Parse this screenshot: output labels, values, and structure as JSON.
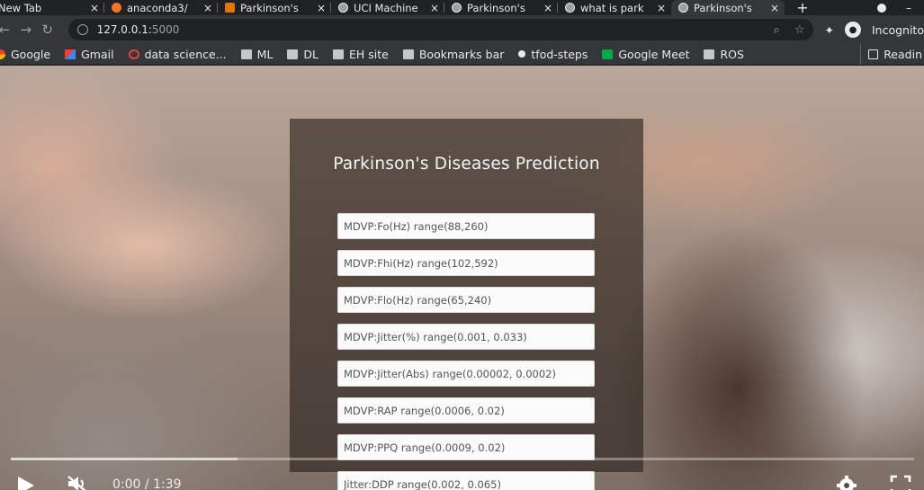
{
  "browser": {
    "tabs": [
      {
        "title": "New Tab",
        "icon": "none",
        "active": false
      },
      {
        "title": "anaconda3/",
        "icon": "jupyter-icon",
        "active": false
      },
      {
        "title": "Parkinson's",
        "icon": "document-icon",
        "active": false
      },
      {
        "title": "UCI Machine",
        "icon": "globe-icon",
        "active": false
      },
      {
        "title": "Parkinson's",
        "icon": "globe-icon",
        "active": false
      },
      {
        "title": "what is park",
        "icon": "globe-icon",
        "active": false
      },
      {
        "title": "Parkinson's",
        "icon": "globe-icon",
        "active": true
      }
    ],
    "tab_close_glyph": "×",
    "new_tab_glyph": "+",
    "url_host": "127.0.0.1:",
    "url_port": "5000",
    "profile_label": "Incognito",
    "bookmarks": [
      {
        "label": "Google",
        "icon": "google-icon"
      },
      {
        "label": "Gmail",
        "icon": "gmail-icon"
      },
      {
        "label": "data science...",
        "icon": "ds-icon"
      },
      {
        "label": "ML",
        "icon": "folder-icon"
      },
      {
        "label": "DL",
        "icon": "folder-icon"
      },
      {
        "label": "EH site",
        "icon": "folder-icon"
      },
      {
        "label": "Bookmarks bar",
        "icon": "folder-icon"
      },
      {
        "label": "tfod-steps",
        "icon": "tf-icon"
      },
      {
        "label": "Google Meet",
        "icon": "meet-icon"
      },
      {
        "label": "ROS",
        "icon": "folder-icon"
      }
    ],
    "reading_list_label": "Readin"
  },
  "page": {
    "title": "Parkinson's Diseases Prediction",
    "fields": [
      "MDVP:Fo(Hz) range(88,260)",
      "MDVP:Fhi(Hz) range(102,592)",
      "MDVP:Flo(Hz) range(65,240)",
      "MDVP:Jitter(%) range(0.001, 0.033)",
      "MDVP:Jitter(Abs) range(0.00002, 0.0002)",
      "MDVP:RAP range(0.0006, 0.02)",
      "MDVP:PPQ range(0.0009, 0.02)",
      "Jitter:DDP range(0.002, 0.065)"
    ]
  },
  "video": {
    "time": "0:00 / 1:39",
    "played_fraction": 0.0,
    "accent_color": "#ff0000"
  }
}
